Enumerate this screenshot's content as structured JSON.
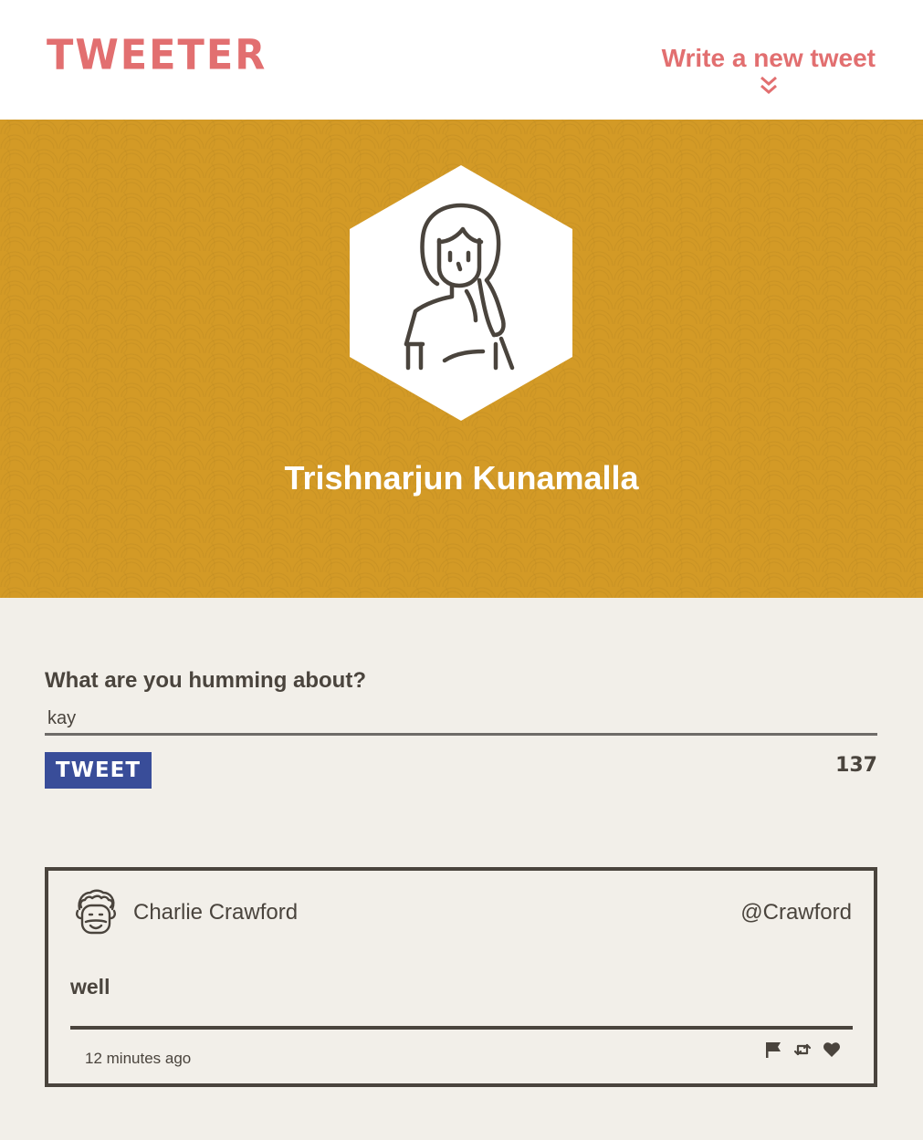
{
  "nav": {
    "brand": "TWEETER",
    "compose_toggle_label": "Write a new tweet",
    "compose_toggle_icon": "double-chevron-down-icon"
  },
  "profile": {
    "name": "Trishnarjun Kunamalla",
    "avatar_icon": "woman-avatar-icon",
    "header_color": "#d39a26"
  },
  "composer": {
    "prompt": "What are you humming about?",
    "input_value": "kay",
    "button_label": "TWEET",
    "char_counter": "137"
  },
  "tweets": [
    {
      "avatar_icon": "man-avatar-icon",
      "name": "Charlie Crawford",
      "handle": "@Crawford",
      "body": "well",
      "time": "12 minutes ago",
      "actions": [
        "flag-icon",
        "retweet-icon",
        "heart-icon"
      ]
    }
  ],
  "colors": {
    "accent": "#e26f70",
    "button": "#394d99",
    "text": "#4a443d",
    "background": "#f2efe9"
  }
}
